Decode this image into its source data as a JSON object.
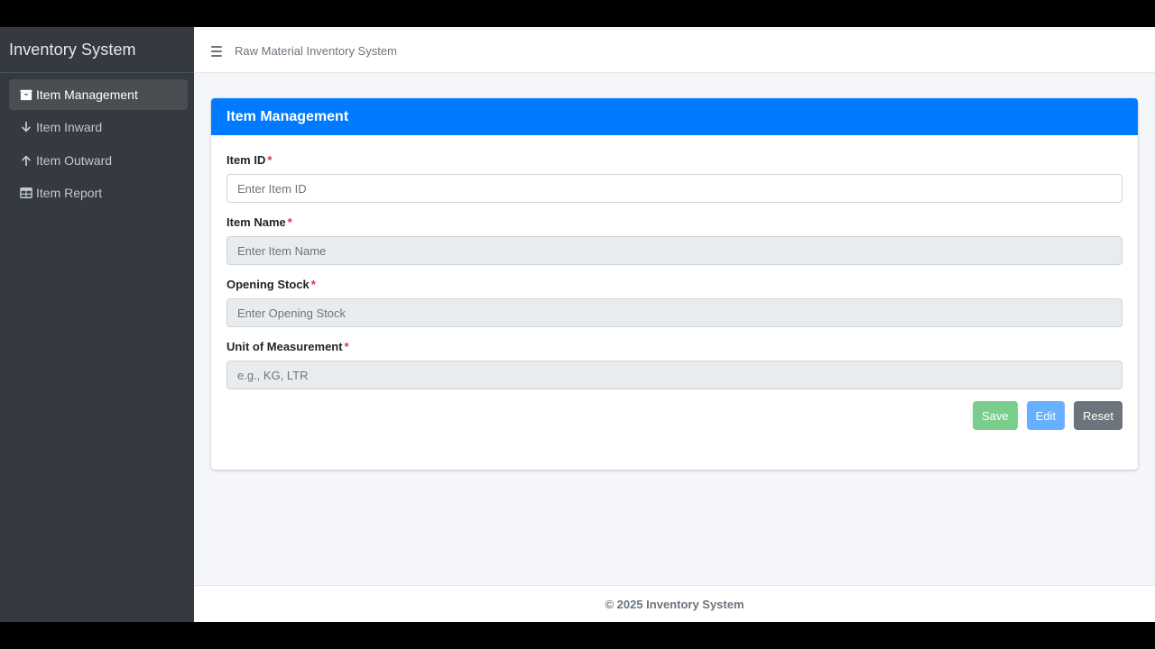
{
  "sidebar": {
    "brand": "Inventory System",
    "items": [
      {
        "label": "Item Management",
        "icon": "box-icon"
      },
      {
        "label": "Item Inward",
        "icon": "arrow-down-icon"
      },
      {
        "label": "Item Outward",
        "icon": "arrow-up-icon"
      },
      {
        "label": "Item Report",
        "icon": "table-icon"
      }
    ]
  },
  "topbar": {
    "title": "Raw Material Inventory System"
  },
  "card": {
    "title": "Item Management",
    "fields": [
      {
        "label": "Item ID",
        "required": "*",
        "placeholder": "Enter Item ID",
        "value": ""
      },
      {
        "label": "Item Name",
        "required": "*",
        "placeholder": "Enter Item Name",
        "value": ""
      },
      {
        "label": "Opening Stock",
        "required": "*",
        "placeholder": "Enter Opening Stock",
        "value": ""
      },
      {
        "label": "Unit of Measurement",
        "required": "*",
        "placeholder": "e.g., KG, LTR",
        "value": ""
      }
    ],
    "buttons": {
      "save": "Save",
      "edit": "Edit",
      "reset": "Reset"
    }
  },
  "footer": {
    "text": "© 2025 Inventory System"
  },
  "colors": {
    "primary": "#007bff",
    "sidebar_bg": "#343a40",
    "save": "#7ace8c",
    "edit": "#66b0ff",
    "reset": "#6c757d",
    "required": "#dc3545"
  }
}
